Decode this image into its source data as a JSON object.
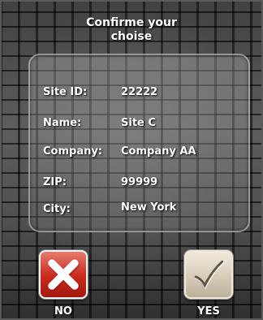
{
  "dialog": {
    "title_line1": "Confirme your",
    "title_line2": "choise"
  },
  "fields": [
    {
      "label": "Site ID:",
      "value": "22222"
    },
    {
      "label": "Name:",
      "value": "Site C"
    },
    {
      "label": "Company:",
      "value": "Company AA"
    },
    {
      "label": "ZIP:",
      "value": "99999"
    },
    {
      "label": "City:",
      "value": "New York"
    }
  ],
  "buttons": {
    "no_label": "NO",
    "yes_label": "YES",
    "no_icon": "close-icon",
    "yes_icon": "checkmark-icon"
  },
  "colors": {
    "no_button": "#c8291a",
    "yes_button": "#d6ccb8"
  }
}
